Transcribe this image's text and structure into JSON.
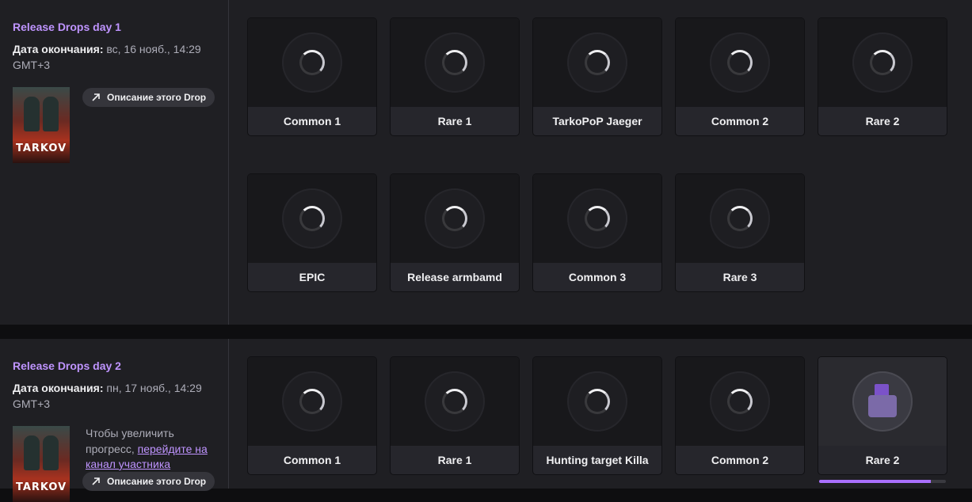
{
  "campaigns": [
    {
      "title": "Release Drops day 1",
      "end_label": "Дата окончания:",
      "end_value": "вс, 16 нояб., 14:29 GMT+3",
      "description_button": "Описание этого Drop",
      "rewards": [
        "Common 1",
        "Rare 1",
        "TarkoPoP Jaeger",
        "Common 2",
        "Rare 2",
        "EPIC",
        "Release armbamd",
        "Common 3",
        "Rare 3"
      ]
    },
    {
      "title": "Release Drops day 2",
      "end_label": "Дата окончания:",
      "end_value": "пн, 17 нояб., 14:29 GMT+3",
      "hint_text": "Чтобы увеличить прогресс,",
      "hint_link": "перейдите на канал участника",
      "description_button": "Описание этого Drop",
      "rewards": [
        "Common 1",
        "Rare 1",
        "Hunting target Killa",
        "Common 2",
        "Rare 2"
      ],
      "active_reward_progress": 0.88
    }
  ],
  "game": {
    "logo_text": "TARKOV"
  },
  "colors": {
    "accent": "#bf94ff",
    "progress": "#a970ff"
  }
}
